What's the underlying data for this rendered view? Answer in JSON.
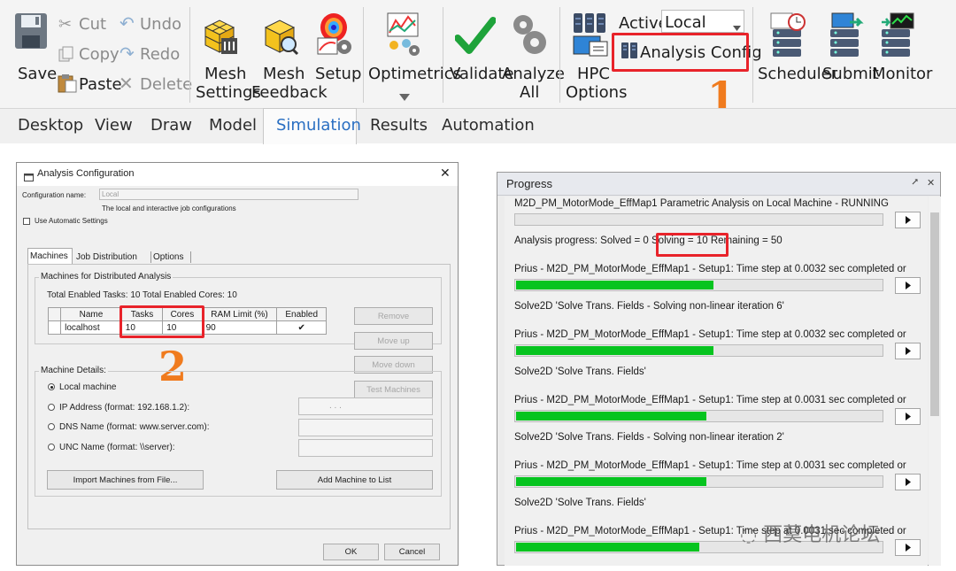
{
  "ribbon": {
    "save_label": "Save",
    "cut_label": "Cut",
    "copy_label": "Copy",
    "paste_label": "Paste",
    "undo_label": "Undo",
    "redo_label": "Redo",
    "delete_label": "Delete",
    "mesh_settings_line1": "Mesh",
    "mesh_settings_line2": "Settings",
    "mesh_feedback_line1": "Mesh",
    "mesh_feedback_line2": "Feedback",
    "setup_label": "Setup",
    "optimetrics_label": "Optimetrics",
    "validate_label": "Validate",
    "analyze_all_line1": "Analyze",
    "analyze_all_line2": "All",
    "hpc_line1": "HPC",
    "hpc_line2": "Options",
    "active_label": "Active:",
    "active_value": "Local",
    "analysis_config_label": "Analysis Config",
    "scheduler_label": "Scheduler",
    "submit_label": "Submit",
    "monitor_label": "Monitor",
    "callout_number": "1"
  },
  "tabs": [
    "Desktop",
    "View",
    "Draw",
    "Model",
    "Simulation",
    "Results",
    "Automation"
  ],
  "dialog": {
    "title": "Analysis Configuration",
    "config_name_label": "Configuration name:",
    "config_name_value": "Local",
    "config_desc": "The local and interactive job configurations",
    "auto_settings_label": "Use Automatic Settings",
    "tabs": [
      "Machines",
      "Job Distribution",
      "Options"
    ],
    "group_machines_title": "Machines for Distributed Analysis",
    "totals_text": "Total Enabled Tasks: 10  Total Enabled Cores: 10",
    "table": {
      "headers": [
        "Name",
        "Tasks",
        "Cores",
        "RAM Limit (%)",
        "Enabled"
      ],
      "rows": [
        {
          "name": "localhost",
          "tasks": "10",
          "cores": "10",
          "ram": "90",
          "enabled": "✔"
        }
      ]
    },
    "remove_label": "Remove",
    "move_up_label": "Move up",
    "move_down_label": "Move down",
    "test_machines_label": "Test Machines",
    "group_details_title": "Machine Details:",
    "radio_local": "Local machine",
    "radio_ip": "IP Address (format: 192.168.1.2):",
    "radio_dns": "DNS Name (format: www.server.com):",
    "radio_unc": "UNC Name (format: \\\\server):",
    "ip_dots": ".        .        .",
    "import_label": "Import Machines from File...",
    "add_machine_label": "Add Machine to List",
    "ok_label": "OK",
    "cancel_label": "Cancel",
    "callout_number": "2"
  },
  "progress": {
    "title": "Progress",
    "pin_icon": "⭧",
    "close_icon": "✕",
    "entries": [
      {
        "text": "M2D_PM_MotorMode_EffMap1 Parametric Analysis on Local Machine - RUNNING",
        "fill": 0
      },
      {
        "text": "Analysis progress:  Solved = 0  Solving = 10  Remaining = 50",
        "fill": null
      },
      {
        "text": "Prius - M2D_PM_MotorMode_EffMap1 - Setup1: Time step at 0.0032 sec completed or",
        "fill": 0.54
      },
      {
        "text": "Solve2D 'Solve Trans. Fields - Solving non-linear iteration 6'",
        "fill": null
      },
      {
        "text": "Prius - M2D_PM_MotorMode_EffMap1 - Setup1: Time step at 0.0032 sec completed or",
        "fill": 0.54
      },
      {
        "text": "Solve2D 'Solve Trans. Fields'",
        "fill": null
      },
      {
        "text": "Prius - M2D_PM_MotorMode_EffMap1 - Setup1: Time step at 0.0031 sec completed or",
        "fill": 0.52
      },
      {
        "text": "Solve2D 'Solve Trans. Fields - Solving non-linear iteration 2'",
        "fill": null
      },
      {
        "text": "Prius - M2D_PM_MotorMode_EffMap1 - Setup1: Time step at 0.0031 sec completed or",
        "fill": 0.52
      },
      {
        "text": "Solve2D 'Solve Trans. Fields'",
        "fill": null
      },
      {
        "text": "Prius - M2D_PM_MotorMode_EffMap1 - Setup1: Time step at 0.0031 sec completed or",
        "fill": 0.5
      }
    ],
    "watermark": "西莫电机论坛"
  },
  "colors": {
    "callout_red": "#e8232a",
    "callout_orange": "#f07b1e",
    "progress_green": "#06c41f",
    "active_tab_blue": "#2a6fc2"
  }
}
